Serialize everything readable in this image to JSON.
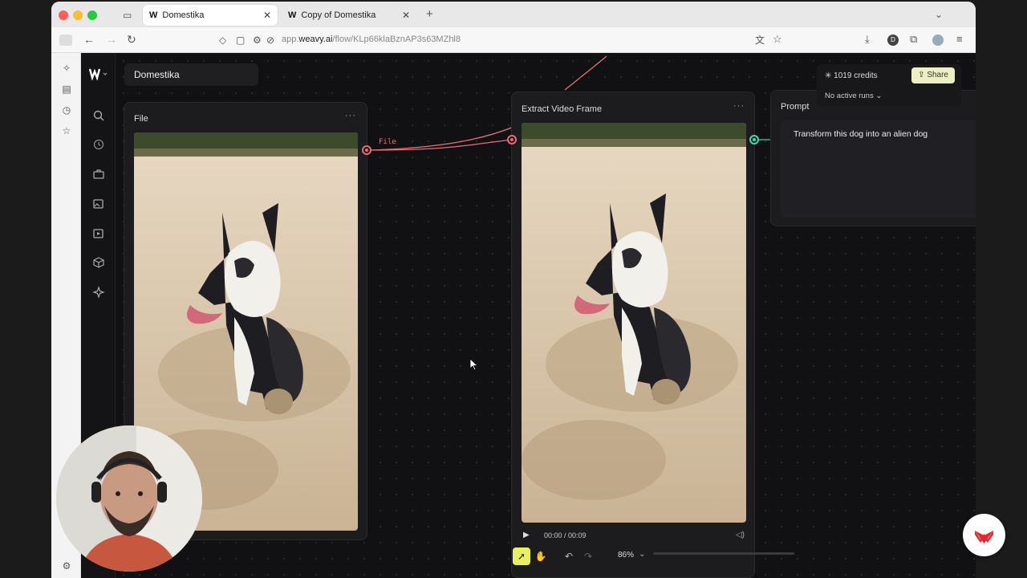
{
  "browser": {
    "tabs": [
      {
        "title": "Domestika",
        "active": true
      },
      {
        "title": "Copy of Domestika",
        "active": false
      }
    ],
    "url": {
      "prefix": "app.",
      "domain": "weavy.ai",
      "path": "/flow/KLp66klaBznAP3s63MZhl8"
    }
  },
  "app": {
    "project_name": "Domestika",
    "credits": "1019 credits",
    "share_label": "Share",
    "runs_label": "No active runs",
    "nodes": {
      "file": {
        "title": "File",
        "menu": "···"
      },
      "extract": {
        "title": "Extract Video Frame",
        "menu": "···",
        "video_time": "00:00 / 00:09"
      },
      "prompt": {
        "title": "Prompt",
        "text": "Transform this dog into an alien dog"
      }
    },
    "edge_label": "File",
    "zoom": "86%"
  },
  "colors": {
    "accent": "#e46e7a",
    "output_port": "#4cd3a5",
    "share_bg": "#ecefc2",
    "canvas_bg": "#111113"
  }
}
